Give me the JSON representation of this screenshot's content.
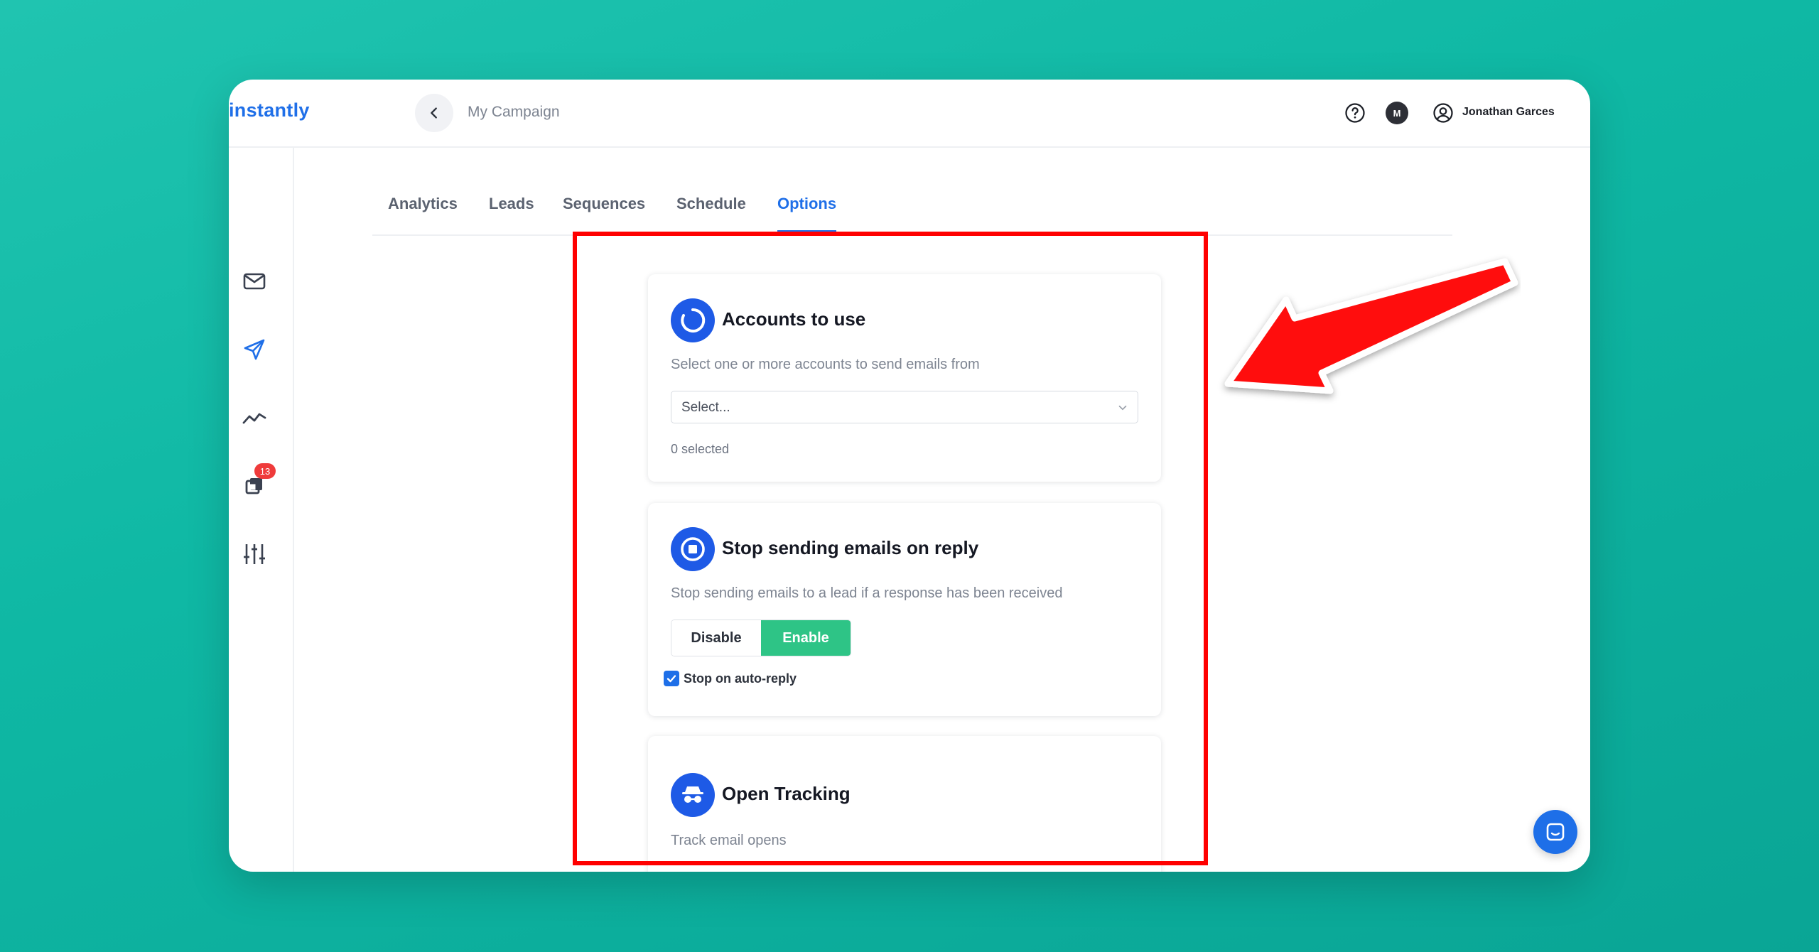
{
  "brand": {
    "logo_text": "instantly",
    "accent": "#1f6fe8"
  },
  "header": {
    "breadcrumb": "My Campaign",
    "workspace_initial": "M",
    "user_name": "Jonathan Garces"
  },
  "sidebar": {
    "items": [
      {
        "icon": "mail-icon"
      },
      {
        "icon": "send-icon"
      },
      {
        "icon": "analytics-icon"
      },
      {
        "icon": "inbox-stack-icon",
        "badge": "13"
      },
      {
        "icon": "sliders-icon"
      },
      {
        "icon": "rocket-icon"
      }
    ]
  },
  "tabs": [
    {
      "label": "Analytics",
      "active": false
    },
    {
      "label": "Leads",
      "active": false
    },
    {
      "label": "Sequences",
      "active": false
    },
    {
      "label": "Schedule",
      "active": false
    },
    {
      "label": "Options",
      "active": true
    }
  ],
  "cards": {
    "accounts": {
      "title": "Accounts to use",
      "description": "Select one or more accounts to send emails from",
      "select_placeholder": "Select...",
      "selected_count": "0 selected"
    },
    "stop_on_reply": {
      "title": "Stop sending emails on reply",
      "description": "Stop sending emails to a lead if a response has been received",
      "disable_label": "Disable",
      "enable_label": "Enable",
      "enabled": true,
      "checkbox_label": "Stop on auto-reply",
      "checkbox_checked": true
    },
    "open_tracking": {
      "title": "Open Tracking",
      "description": "Track email opens"
    }
  },
  "colors": {
    "background": "#0fb8a4",
    "enable_green": "#2ec486",
    "badge_red": "#ef3b3b",
    "annotation_red": "#ff0000",
    "icon_blue": "#1e5ae6"
  }
}
